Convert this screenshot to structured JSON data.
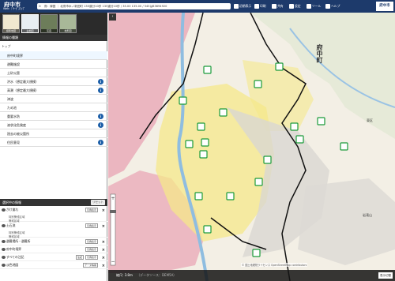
{
  "header": {
    "logo_title": "府中市",
    "logo_subtitle": "Web ｜ｻｰﾋﾞｽﾏｯﾌﾟ",
    "address": "府：緑図 ｜ 北府市木ノ新田町 135道分10秒 135道分10秒 / 35.00 135.00 / 545は63694920",
    "buttons": [
      "初期表示",
      "印刷",
      "共有",
      "設定",
      "ツール",
      "ヘルプ"
    ],
    "brand": "府中市"
  },
  "map_types": [
    {
      "label": "標準地図"
    },
    {
      "label": "白地図"
    },
    {
      "label": "写真"
    },
    {
      "label": "地形図"
    }
  ],
  "sidebar": {
    "section_title": "情報の種類",
    "category": "トップ",
    "items": [
      {
        "label": "府中町境界",
        "info": false,
        "selected": true
      },
      {
        "label": "避難施設",
        "info": false,
        "selected": false
      },
      {
        "label": "土砂災害",
        "info": false,
        "selected": false
      },
      {
        "label": "洪水（想定最大規模）",
        "info": true,
        "selected": false
      },
      {
        "label": "高潮（想定最大規模）",
        "info": true,
        "selected": false
      },
      {
        "label": "津波",
        "info": false,
        "selected": false
      },
      {
        "label": "ため池",
        "info": false,
        "selected": false
      },
      {
        "label": "重要水防",
        "info": true,
        "selected": false
      },
      {
        "label": "液状化危険度",
        "info": true,
        "selected": false
      },
      {
        "label": "過去の被災箇所",
        "info": false,
        "selected": false
      },
      {
        "label": "住民意見",
        "info": true,
        "selected": false
      }
    ],
    "selected_title": "選択中の情報",
    "reset_label": "リセット",
    "active_layers": [
      {
        "label": "がけ崩れ",
        "sub": [
          "特別警戒区域",
          "警戒区域"
        ],
        "legend": "凡例表示"
      },
      {
        "label": "土石流",
        "sub": [
          "特別警戒区域",
          "警戒区域"
        ],
        "legend": "凡例表示"
      },
      {
        "label": "避難場所・避難所",
        "sub": [],
        "legend": "凡例表示"
      },
      {
        "label": "府中町境界",
        "sub": [],
        "legend": "凡例表示"
      },
      {
        "label": "すべての注記",
        "sub": [],
        "legend": "凡例表示",
        "extra": "注記"
      },
      {
        "label": "淡色地図",
        "sub": [],
        "legend": "データ情報"
      }
    ]
  },
  "map": {
    "town_label": "府中町",
    "place_labels": [
      "東区",
      "岩滝山"
    ],
    "scale_text": "縮尺: 3.8m",
    "data_source": "（データソース：DEM5A）",
    "attribution": "© 国土地理院ライセンス OpenStreetMap contributors",
    "toggle_button": "表示切替",
    "collapse_icon": "‹"
  },
  "colors": {
    "header_bg": "#1d3a6b",
    "danger_red": "#e8a3b3",
    "warning_yellow": "#f5e88a",
    "shelter_green": "#1a9b3a",
    "info_blue": "#1d5fa8"
  }
}
